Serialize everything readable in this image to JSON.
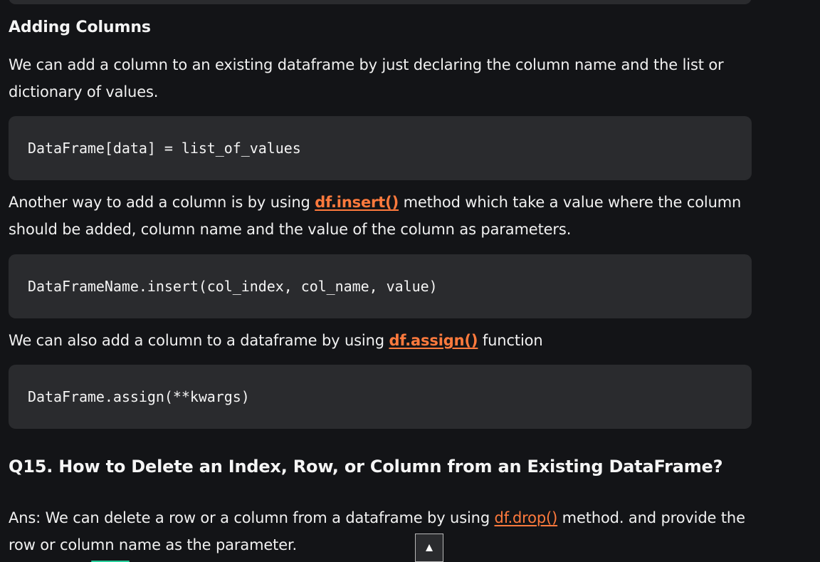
{
  "section": {
    "title": "Adding Columns"
  },
  "paragraphs": {
    "intro": {
      "line1": "We can add a column to an existing dataframe by just declaring the column name and the list or",
      "line2": "dictionary of values."
    },
    "insert": {
      "before": "Another way to add a column is by using ",
      "link": "df.insert()",
      "after": " method which take a value where the column",
      "line2": "should be added, column name and the value of the column as parameters."
    },
    "assign": {
      "before": "We can also add a column to a dataframe by using ",
      "link": "df.assign()",
      "after": " function"
    },
    "drop": {
      "before": "Ans: We can delete a row or a column from a dataframe by using ",
      "link": "df.drop()",
      "after": " method. and provide the",
      "line2": "row or column name as the parameter."
    }
  },
  "code_blocks": {
    "add_column": "DataFrame[data] = list_of_values",
    "insert_column": "DataFrameName.insert(col_index, col_name, value)",
    "assign_column": "DataFrame.assign(**kwargs)"
  },
  "question": {
    "title": "Q15. How to Delete an Index, Row, or Column from an Existing DataFrame?"
  },
  "controls": {
    "scroll_top_icon": "▲"
  },
  "icons": {
    "scroll_top": "up-arrow-icon"
  },
  "colors": {
    "background": "#131417",
    "code_background": "#2a2b2e",
    "link": "#ff7a3d",
    "accent": "#27d19d",
    "text": "#f1f1f1"
  }
}
